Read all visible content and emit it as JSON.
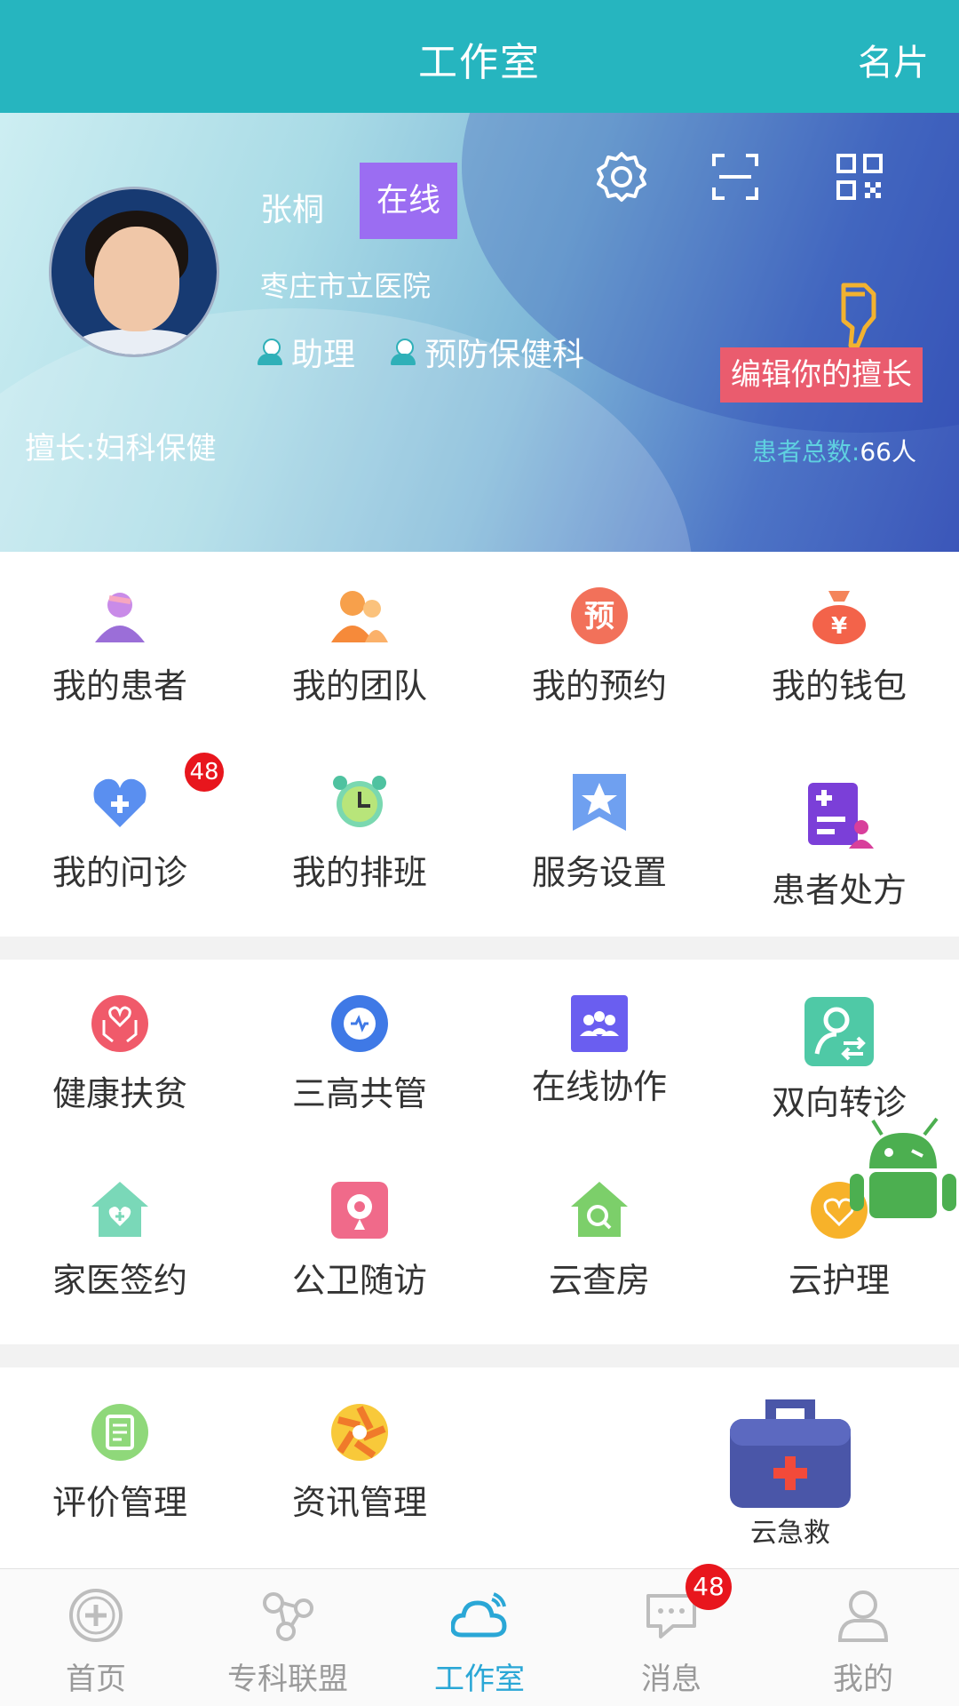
{
  "header": {
    "title": "工作室",
    "card_button": "名片"
  },
  "profile": {
    "name": "张桐",
    "status": "在线",
    "hospital": "枣庄市立医院",
    "tags": [
      "助理",
      "预防保健科"
    ],
    "specialty": "擅长:妇科保健",
    "edit_button": "编辑你的擅长",
    "patient_total_label": "患者总数:",
    "patient_total_value": "66人"
  },
  "colors": {
    "accent": "#26b5bf",
    "online": "#9b6df2",
    "edit": "#ea5c6e",
    "badge": "#e8161d",
    "nav_active": "#2aa7d6"
  },
  "grid1": [
    {
      "label": "我的患者",
      "icon": "patient-icon"
    },
    {
      "label": "我的团队",
      "icon": "team-icon"
    },
    {
      "label": "我的预约",
      "icon": "appointment-icon",
      "glyph": "预"
    },
    {
      "label": "我的钱包",
      "icon": "wallet-icon",
      "glyph": "¥"
    },
    {
      "label": "我的问诊",
      "icon": "consultation-icon",
      "badge": "48"
    },
    {
      "label": "我的排班",
      "icon": "alarm-icon"
    },
    {
      "label": "服务设置",
      "icon": "service-settings-icon"
    },
    {
      "label": "患者处方",
      "icon": "prescription-icon"
    }
  ],
  "grid2": [
    {
      "label": "健康扶贫",
      "icon": "health-poverty-icon"
    },
    {
      "label": "三高共管",
      "icon": "heart-monitor-icon"
    },
    {
      "label": "在线协作",
      "icon": "collaboration-icon"
    },
    {
      "label": "双向转诊",
      "icon": "referral-icon"
    },
    {
      "label": "家医签约",
      "icon": "family-doctor-icon"
    },
    {
      "label": "公卫随访",
      "icon": "followup-icon"
    },
    {
      "label": "云查房",
      "icon": "cloud-rounds-icon"
    },
    {
      "label": "云护理",
      "icon": "cloud-nursing-icon"
    }
  ],
  "grid3": [
    {
      "label": "评价管理",
      "icon": "review-icon"
    },
    {
      "label": "资讯管理",
      "icon": "news-icon"
    }
  ],
  "emergency": {
    "label": "云急救"
  },
  "bottom_nav": [
    {
      "label": "首页",
      "icon": "home-icon"
    },
    {
      "label": "专科联盟",
      "icon": "alliance-icon"
    },
    {
      "label": "工作室",
      "icon": "studio-icon",
      "active": true
    },
    {
      "label": "消息",
      "icon": "message-icon",
      "badge": "48"
    },
    {
      "label": "我的",
      "icon": "profile-icon"
    }
  ]
}
